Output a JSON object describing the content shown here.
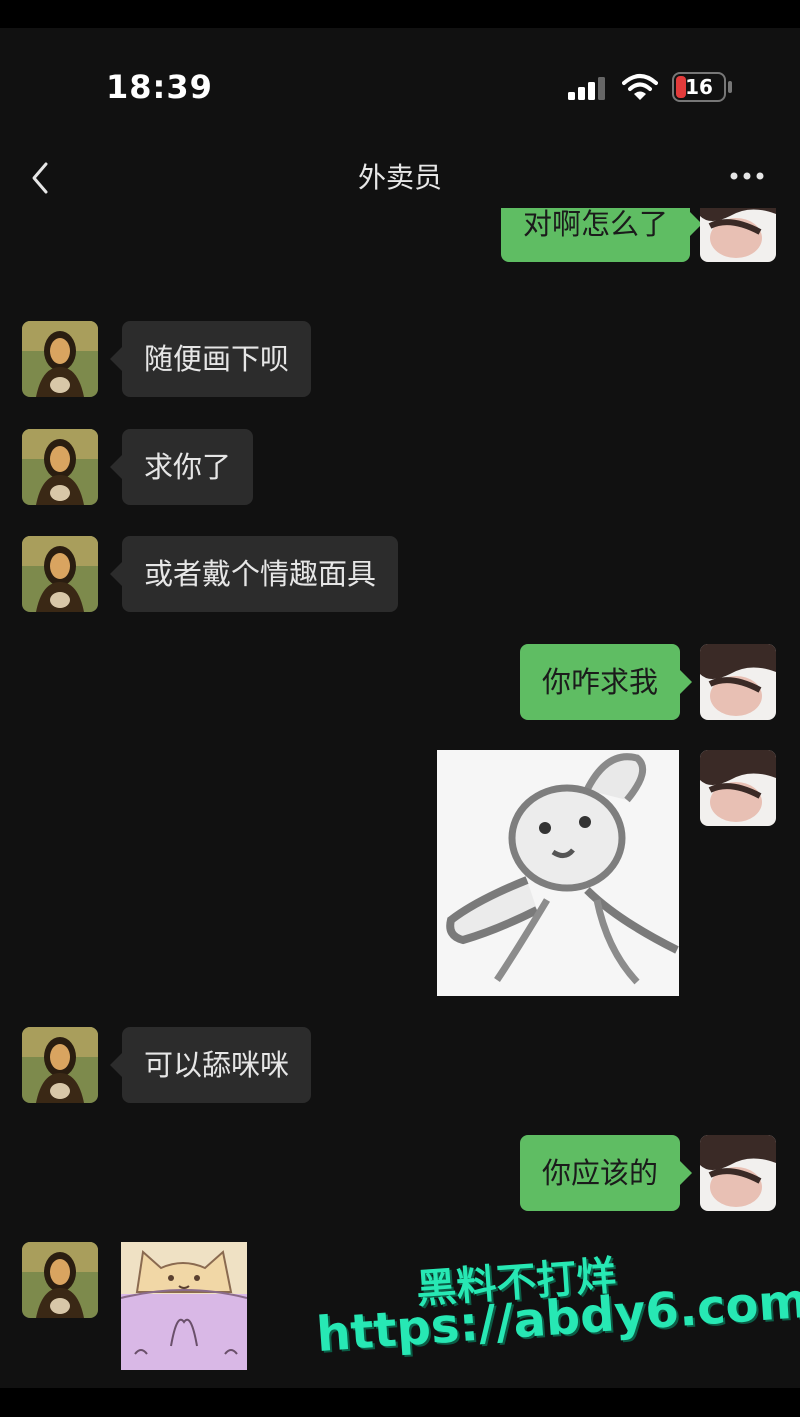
{
  "status_bar": {
    "time": "18:39",
    "battery": "16"
  },
  "header": {
    "title": "外卖员"
  },
  "messages": [
    {
      "side": "out",
      "text": "对啊怎么了"
    },
    {
      "side": "in",
      "text": "随便画下呗"
    },
    {
      "side": "in",
      "text": "求你了"
    },
    {
      "side": "in",
      "text": "或者戴个情趣面具"
    },
    {
      "side": "out",
      "text": "你咋求我"
    },
    {
      "side": "out",
      "type": "sticker",
      "icon": "bunny-sketch-sticker"
    },
    {
      "side": "in",
      "text": "可以舔咪咪"
    },
    {
      "side": "out",
      "text": "你应该的"
    },
    {
      "side": "in",
      "type": "sticker",
      "icon": "cat-sticker"
    }
  ],
  "watermark": {
    "line1": "黑料不打烊",
    "line2": "https://abdy6.com"
  },
  "colors": {
    "background": "#111111",
    "incoming": "#2c2c2c",
    "outgoing": "#5fbd63",
    "watermark": "#27e8b4"
  }
}
